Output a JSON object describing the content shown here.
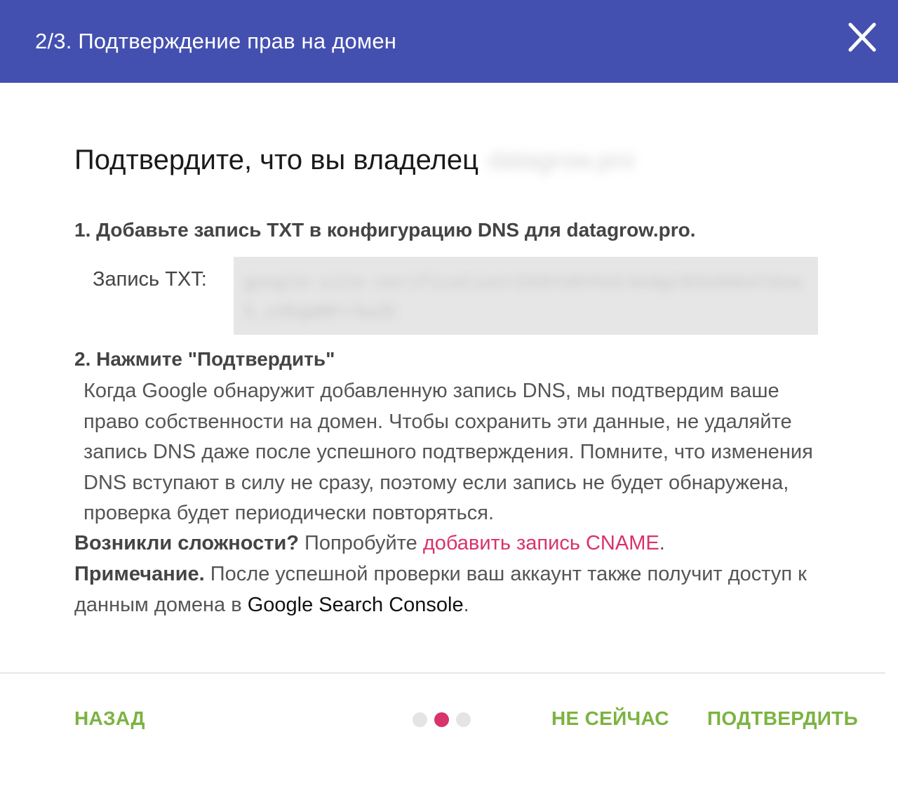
{
  "header": {
    "title": "2/3. Подтверждение прав на домен",
    "close_icon": "close-icon"
  },
  "main": {
    "heading": "Подтвердите, что вы владелец",
    "heading_domain": "datagrow.pro",
    "step1_title": "1. Добавьте запись TXT в конфигурацию DNS для datagrow.pro.",
    "txt_label": "Запись TXT:",
    "txt_value": "google-site-verification=ZX9YU9YhUt4edgt8Xk0Ab47dzw5_zdbgWNFr5wZE",
    "step2_title": "2. Нажмите \"Подтвердить\"",
    "step2_body": "Когда Google обнаружит добавленную запись DNS, мы подтвердим ваше право собственности на домен. Чтобы сохранить эти данные, не удаляйте запись DNS даже после успешного подтверждения. Помните, что изменения DNS вступают в силу не сразу, поэтому если запись не будет обнаружена, проверка будет периодически повторяться.",
    "trouble_bold": "Возникли сложности?",
    "trouble_text": " Попробуйте ",
    "trouble_link": "добавить запись CNAME",
    "trouble_end": ".",
    "note_bold": "Примечание.",
    "note_text": " После успешной проверки ваш аккаунт также получит доступ к данным домена в ",
    "note_gsc": "Google Search Console",
    "note_end": "."
  },
  "footer": {
    "back_label": "НАЗАД",
    "not_now_label": "НЕ СЕЙЧАС",
    "confirm_label": "ПОДТВЕРДИТЬ",
    "step_dots": {
      "total": 3,
      "current": 2
    }
  },
  "colors": {
    "header_bg": "#4450b0",
    "accent_green": "#7cb342",
    "link_pink": "#d8336b"
  }
}
